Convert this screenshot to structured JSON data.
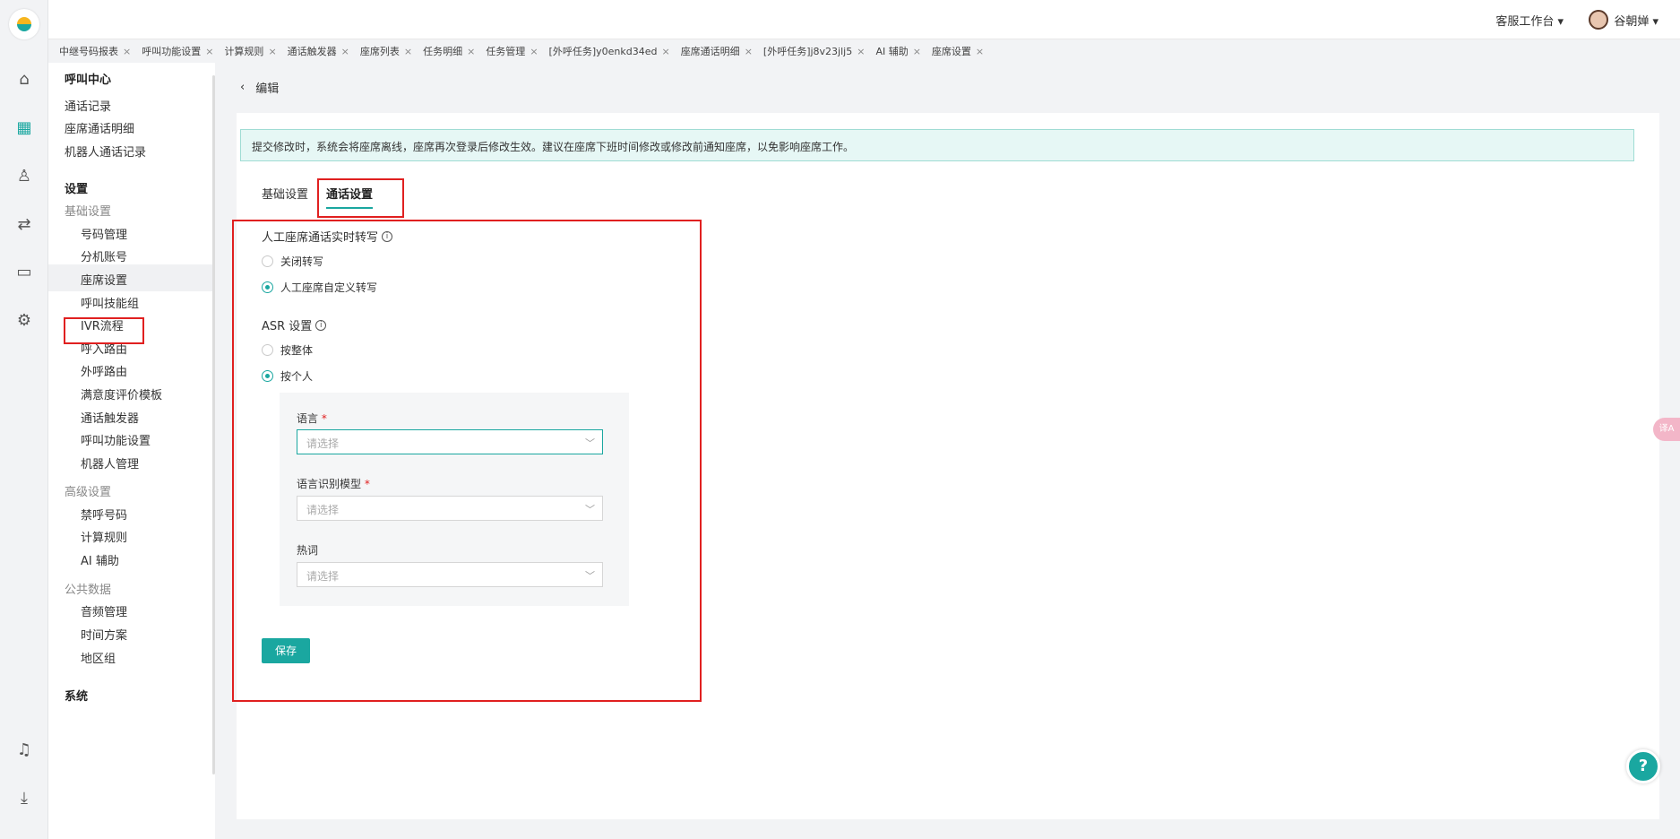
{
  "topbar": {
    "workspace": "客服工作台 ▾",
    "user_name": "谷朝婵 ▾"
  },
  "tabs": [
    "中继号码报表",
    "呼叫功能设置",
    "计算规则",
    "通话触发器",
    "座席列表",
    "任务明细",
    "任务管理",
    "[外呼任务]y0enkd34ed",
    "座席通话明细",
    "[外呼任务]j8v23jlj5",
    "AI 辅助",
    "座席设置"
  ],
  "rail_icons": [
    "home-icon",
    "apps-icon",
    "user-icon",
    "route-icon",
    "book-icon",
    "settings-icon",
    "bell-icon",
    "download-icon"
  ],
  "sidebar": {
    "call_center": "呼叫中心",
    "call_records": "通话记录",
    "agent_call_detail": "座席通话明细",
    "robot_call_records": "机器人通话记录",
    "settings": "设置",
    "basic_settings": "基础设置",
    "basic_items": [
      "号码管理",
      "分机账号",
      "座席设置",
      "呼叫技能组",
      "IVR流程",
      "呼入路由",
      "外呼路由",
      "满意度评价模板",
      "通话触发器",
      "呼叫功能设置",
      "机器人管理"
    ],
    "advanced_settings": "高级设置",
    "advanced_items": [
      "禁呼号码",
      "计算规则",
      "AI 辅助"
    ],
    "public_data": "公共数据",
    "public_items": [
      "音频管理",
      "时间方案",
      "地区组"
    ],
    "system": "系统"
  },
  "page": {
    "back_title": "编辑",
    "notice": "提交修改时，系统会将座席离线，座席再次登录后修改生效。建议在座席下班时间修改或修改前通知座席，以免影响座席工作。",
    "tab_basic": "基础设置",
    "tab_call": "通话设置",
    "transcribe_label": "人工座席通话实时转写",
    "transcribe_off": "关闭转写",
    "transcribe_custom": "人工座席自定义转写",
    "asr_label": "ASR 设置",
    "asr_whole": "按整体",
    "asr_person": "按个人",
    "language_label": "语言",
    "model_label": "语言识别模型",
    "hotword_label": "热词",
    "placeholder": "请选择",
    "required_mark": "*",
    "save": "保存"
  },
  "floating": {
    "help": "?",
    "translate": "译A"
  },
  "colors": {
    "accent": "#1aa7a0",
    "highlight": "#e02020",
    "notice_bg": "#e6f7f5"
  }
}
